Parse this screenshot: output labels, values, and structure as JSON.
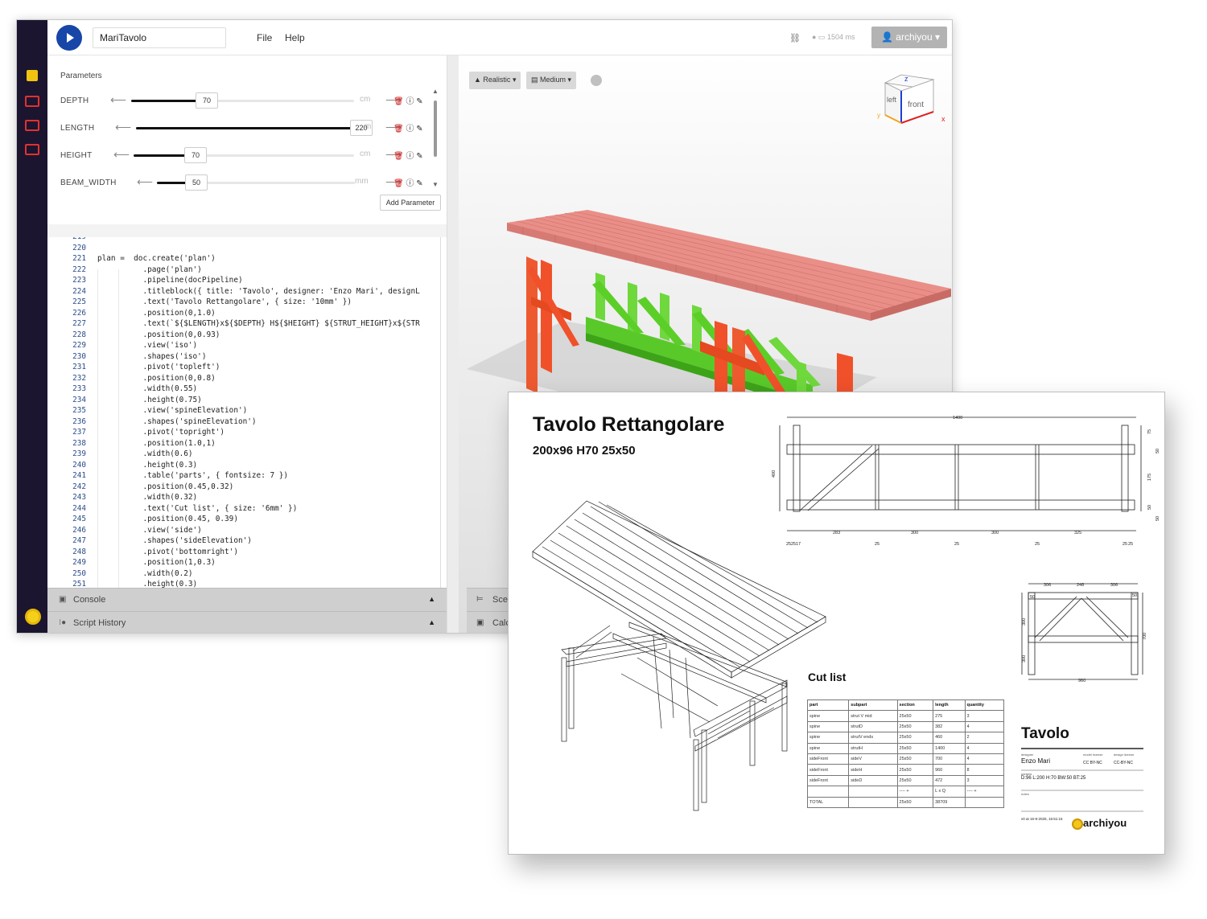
{
  "app": {
    "project_name": "MariTavolo",
    "menu": {
      "file": "File",
      "help": "Help"
    },
    "link_icon": "link-icon",
    "timing": "1504 ms",
    "user_label": "archiyou",
    "user_caret": "▾"
  },
  "parameters": {
    "title": "Parameters",
    "add_label": "Add Parameter",
    "rows": [
      {
        "name": "DEPTH",
        "value": "70",
        "unit": "cm",
        "fraction": 0.34
      },
      {
        "name": "LENGTH",
        "value": "220",
        "unit": "m",
        "fraction": 0.98
      },
      {
        "name": "HEIGHT",
        "value": "70",
        "unit": "cm",
        "fraction": 0.28
      },
      {
        "name": "BEAM_WIDTH",
        "value": "50",
        "unit": "mm",
        "fraction": 0.2
      }
    ]
  },
  "code": {
    "lines": [
      {
        "n": "219",
        "t": ""
      },
      {
        "n": "220",
        "t": ""
      },
      {
        "n": "221",
        "t": "plan =  doc.create('plan')"
      },
      {
        "n": "222",
        "t": "          .page('plan')"
      },
      {
        "n": "223",
        "t": "          .pipeline(docPipeline)"
      },
      {
        "n": "224",
        "t": "          .titleblock({ title: 'Tavolo', designer: 'Enzo Mari', designL"
      },
      {
        "n": "225",
        "t": "          .text('Tavolo Rettangolare', { size: '10mm' })"
      },
      {
        "n": "226",
        "t": "          .position(0,1.0)"
      },
      {
        "n": "227",
        "t": "          .text(`${$LENGTH}x${$DEPTH} H${$HEIGHT} ${STRUT_HEIGHT}x${STR"
      },
      {
        "n": "228",
        "t": "          .position(0,0.93)"
      },
      {
        "n": "229",
        "t": "          .view('iso')"
      },
      {
        "n": "230",
        "t": "          .shapes('iso')"
      },
      {
        "n": "231",
        "t": "          .pivot('topleft')"
      },
      {
        "n": "232",
        "t": "          .position(0,0.8)"
      },
      {
        "n": "233",
        "t": "          .width(0.55)"
      },
      {
        "n": "234",
        "t": "          .height(0.75)"
      },
      {
        "n": "235",
        "t": "          .view('spineElevation')"
      },
      {
        "n": "236",
        "t": "          .shapes('spineElevation')"
      },
      {
        "n": "237",
        "t": "          .pivot('topright')"
      },
      {
        "n": "238",
        "t": "          .position(1.0,1)"
      },
      {
        "n": "239",
        "t": "          .width(0.6)"
      },
      {
        "n": "240",
        "t": "          .height(0.3)"
      },
      {
        "n": "241",
        "t": "          .table('parts', { fontsize: 7 })"
      },
      {
        "n": "242",
        "t": "          .position(0.45,0.32)"
      },
      {
        "n": "243",
        "t": "          .width(0.32)"
      },
      {
        "n": "244",
        "t": "          .text('Cut list', { size: '6mm' })"
      },
      {
        "n": "245",
        "t": "          .position(0.45, 0.39)"
      },
      {
        "n": "246",
        "t": "          .view('side')"
      },
      {
        "n": "247",
        "t": "          .shapes('sideElevation')"
      },
      {
        "n": "248",
        "t": "          .pivot('bottomright')"
      },
      {
        "n": "249",
        "t": "          .position(1,0.3)"
      },
      {
        "n": "250",
        "t": "          .width(0.2)"
      },
      {
        "n": "251",
        "t": "          .height(0.3)"
      }
    ]
  },
  "panels": {
    "console": "Console",
    "history": "Script History",
    "scene": "Scen",
    "calc": "Calc"
  },
  "viewport": {
    "render_mode": "Realistic",
    "quality": "Medium",
    "cube_top": "z",
    "cube_left": "left",
    "cube_front": "front",
    "axis_y": "y",
    "axis_x": "x",
    "colors": {
      "top": "#e98f88",
      "legs": "#f0512a",
      "struts": "#5ad12c"
    }
  },
  "sheet": {
    "title": "Tavolo Rettangolare",
    "subtitle": "200x96 H70 25x50",
    "cut_list_title": "Cut list",
    "cut_list": {
      "headers": [
        "part",
        "subpart",
        "section",
        "length",
        "quantity"
      ],
      "rows": [
        [
          "spine",
          "strut V mid",
          "25x50",
          "275",
          "3"
        ],
        [
          "spine",
          "strutD",
          "25x50",
          "382",
          "4"
        ],
        [
          "spine",
          "strutV ends",
          "25x50",
          "460",
          "2"
        ],
        [
          "spine",
          "strutH",
          "25x50",
          "1400",
          "4"
        ],
        [
          "sideFront",
          "sideV",
          "25x50",
          "700",
          "4"
        ],
        [
          "sideFront",
          "sideH",
          "25x50",
          "960",
          "8"
        ],
        [
          "sideFront",
          "sideD",
          "25x50",
          "472",
          "3"
        ],
        [
          "",
          "",
          "---- +",
          "L x Q",
          "---- +"
        ],
        [
          "TOTAL",
          "",
          "25x50",
          "38709",
          ""
        ]
      ]
    },
    "dims_top": {
      "overall": "1400",
      "bottom": [
        "25",
        "25",
        "17",
        "283",
        "25",
        "300",
        "25",
        "300",
        "25",
        "325",
        "25",
        "25"
      ],
      "left": "400",
      "right": [
        "75",
        "50",
        "175",
        "50",
        "50"
      ]
    },
    "dims_side": {
      "top": [
        "306",
        "248",
        "306"
      ],
      "bottom": "960",
      "left": [
        "50",
        "300",
        "300"
      ],
      "right": "700",
      "right_top": "50"
    },
    "titleblock": {
      "title": "Tavolo",
      "designer_label": "designer",
      "designer": "Enzo Mari",
      "model_license_label": "model license",
      "model_license": "CC BY-NC",
      "design_license_label": "design license",
      "design_license": "CC-BY-NC",
      "params_label": "params",
      "params": "D:96 L:200 H:70 BW:50 BT:25",
      "notes_label": "notes",
      "version": "v0 at 16-9-2025, 15:51:16",
      "brand": "archiyou"
    }
  }
}
